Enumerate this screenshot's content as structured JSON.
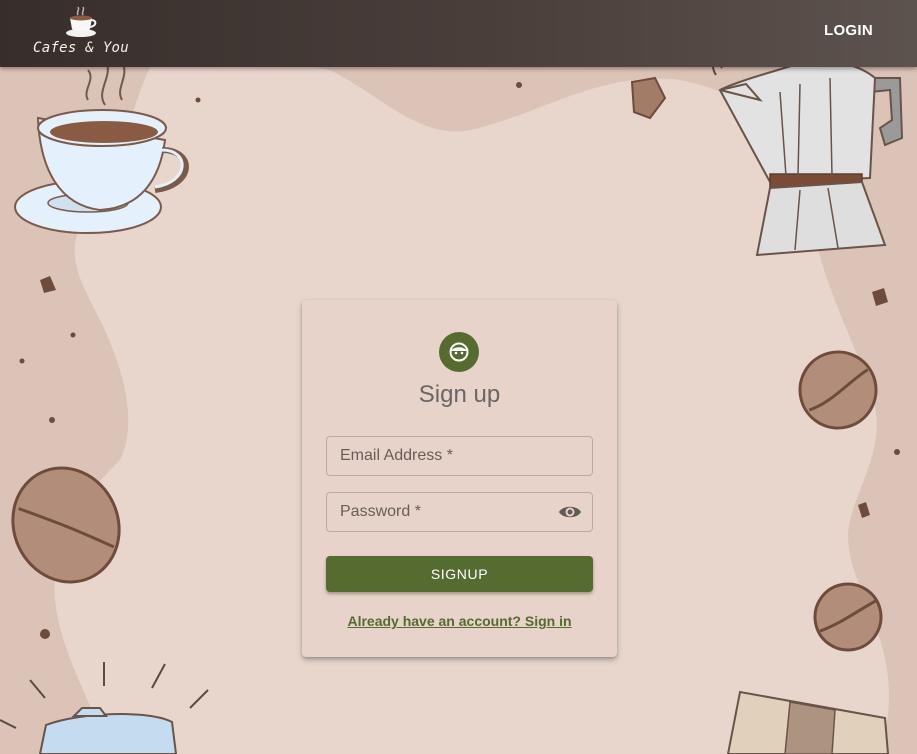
{
  "app": {
    "brand_name": "Cafes & You",
    "brand_icon": "coffee-cup-icon",
    "login_label": "LOGIN"
  },
  "signup_form": {
    "avatar_icon": "face-icon",
    "title": "Sign up",
    "email_label": "Email Address *",
    "password_label": "Password *",
    "password_toggle_icon": "eye-icon",
    "submit_label": "SIGNUP",
    "signin_link": "Already have an account? Sign in"
  },
  "colors": {
    "accent": "#556b2f",
    "topbar": "#3c3330",
    "card": "#e7d3ca",
    "background": "#dcc5b8"
  }
}
